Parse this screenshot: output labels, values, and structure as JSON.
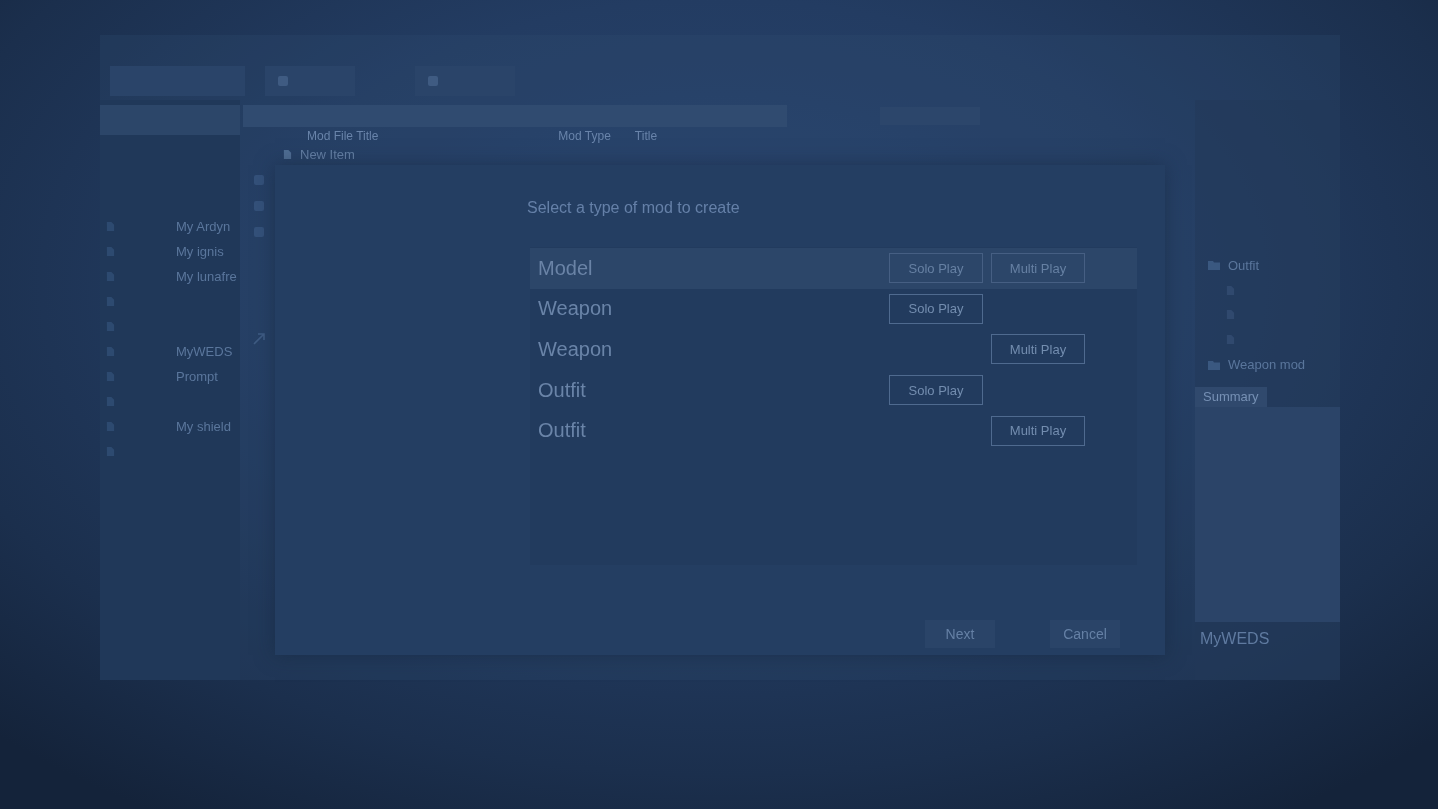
{
  "tabs": [
    {
      "kind": "plain"
    },
    {
      "kind": "icon"
    },
    {
      "kind": "icon"
    }
  ],
  "sidebar": {
    "items": [
      {
        "kind": "file",
        "label": "My Ardyn"
      },
      {
        "kind": "file",
        "label": "My ignis"
      },
      {
        "kind": "file",
        "label": "My lunafre"
      },
      {
        "kind": "file"
      },
      {
        "kind": "file"
      },
      {
        "kind": "file",
        "label": "MyWEDS"
      },
      {
        "kind": "file",
        "label": "Prompt"
      },
      {
        "kind": "file"
      },
      {
        "kind": "file",
        "label": "My shield"
      },
      {
        "kind": "file"
      }
    ]
  },
  "item_list": {
    "columns": [
      "Mod File Title",
      "Mod Type",
      "Title"
    ],
    "rows": [
      {
        "label": "New Item"
      }
    ]
  },
  "dialog": {
    "title": "Select a type of mod to create",
    "options": [
      {
        "label": "Model",
        "selected": true,
        "buttons": [
          {
            "kind": "solo",
            "label": "Solo Play"
          },
          {
            "kind": "multi",
            "label": "Multi Play"
          }
        ]
      },
      {
        "label": "Weapon",
        "selected": false,
        "buttons": [
          {
            "kind": "solo",
            "label": "Solo Play"
          }
        ]
      },
      {
        "label": "Weapon",
        "selected": false,
        "buttons": [
          {
            "kind": "multi",
            "label": "Multi Play"
          }
        ]
      },
      {
        "label": "Outfit",
        "selected": false,
        "buttons": [
          {
            "kind": "solo",
            "label": "Solo Play"
          }
        ]
      },
      {
        "label": "Outfit",
        "selected": false,
        "buttons": [
          {
            "kind": "multi",
            "label": "Multi Play"
          }
        ]
      }
    ],
    "footer_buttons": [
      "Next",
      "Cancel"
    ]
  },
  "right_panel": {
    "tree": [
      {
        "kind": "folder",
        "label": "Outfit",
        "children": [
          {
            "kind": "file"
          },
          {
            "kind": "file"
          },
          {
            "kind": "file"
          }
        ]
      },
      {
        "kind": "folder",
        "label": "Weapon mod"
      }
    ],
    "tab": "Summary",
    "caption": "MyWEDS"
  }
}
